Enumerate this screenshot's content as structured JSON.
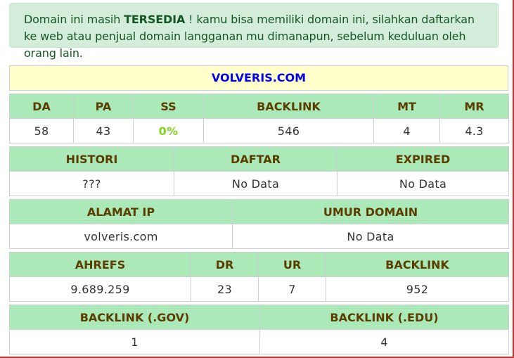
{
  "alert": {
    "prefix": "Domain ini masih ",
    "status": "TERSEDIA",
    "suffix": " ! kamu bisa memiliki domain ini, silahkan daftarkan ke web atau penjual domain langganan mu dimanapun, sebelum keduluan oleh orang lain."
  },
  "domain": "VOLVERIS.COM",
  "metrics": {
    "headers": {
      "da": "DA",
      "pa": "PA",
      "ss": "SS",
      "backlink": "BACKLINK",
      "mt": "MT",
      "mr": "MR"
    },
    "values": {
      "da": "58",
      "pa": "43",
      "ss": "0%",
      "backlink": "546",
      "mt": "4",
      "mr": "4.3"
    }
  },
  "registration": {
    "headers": {
      "histori": "HISTORI",
      "daftar": "DAFTAR",
      "expired": "EXPIRED"
    },
    "values": {
      "histori": "???",
      "daftar": "No Data",
      "expired": "No Data"
    }
  },
  "hosting": {
    "headers": {
      "ip": "ALAMAT IP",
      "age": "UMUR DOMAIN"
    },
    "values": {
      "ip": "volveris.com",
      "age": "No Data"
    }
  },
  "ahrefs": {
    "headers": {
      "ahrefs": "AHREFS",
      "dr": "DR",
      "ur": "UR",
      "backlink": "BACKLINK"
    },
    "values": {
      "ahrefs": "9.689.259",
      "dr": "23",
      "ur": "7",
      "backlink": "952"
    }
  },
  "special_backlinks": {
    "headers": {
      "gov": "BACKLINK (.GOV)",
      "edu": "BACKLINK (.EDU)"
    },
    "values": {
      "gov": "1",
      "edu": "4"
    }
  },
  "colors": {
    "alert_bg": "#d4edda",
    "alert_text": "#155724",
    "header_bg": "#abe9b8",
    "header_text": "#5b3d00",
    "domain_bg": "#ffffcc",
    "domain_text": "#0000ee",
    "ss_value": "#7ed321"
  }
}
